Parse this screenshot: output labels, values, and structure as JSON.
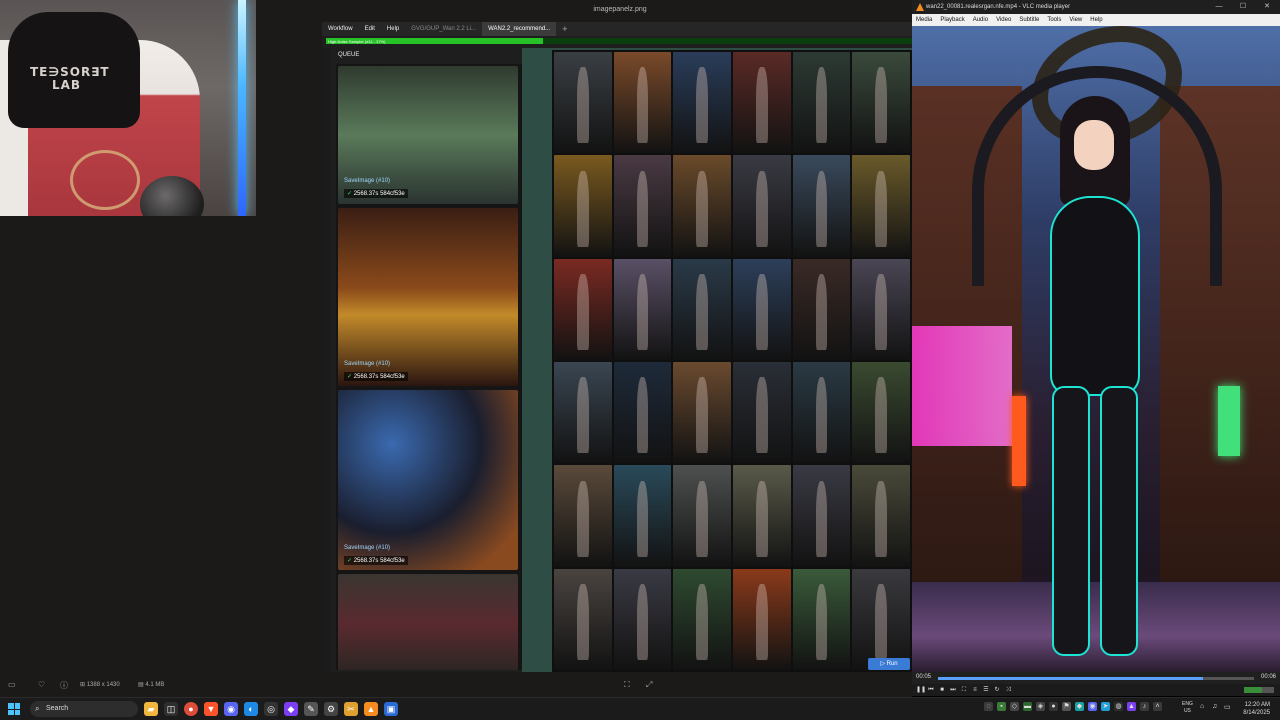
{
  "webcam": {
    "chair_logo_line1": "TE∋SOR∃T",
    "chair_logo_line2": "LAB"
  },
  "image_viewer": {
    "title": "imagepanelz.png",
    "dimensions": "1388 x 1430",
    "file_size": "4.1 MB"
  },
  "comfy": {
    "menu": [
      "Workflow",
      "Edit",
      "Help"
    ],
    "tabs": [
      {
        "label": "GVG/GUP_Wan 2.2 Li...",
        "active": false
      },
      {
        "label": "WAN2.2_recommend...",
        "active": true
      }
    ],
    "add_tab": "+",
    "progress_label": "High-Noise Sampler (#11 - 37%)",
    "progress_fraction": 0.37,
    "queue_title": "QUEUE",
    "queue_items": [
      {
        "node": "SaveImage (#10)",
        "time": "2568.37s",
        "hash": "584cf53e"
      },
      {
        "node": "SaveImage (#10)",
        "time": "2568.37s",
        "hash": "584cf53e"
      },
      {
        "node": "SaveImage (#10)",
        "time": "2568.37s",
        "hash": "584cf53e"
      }
    ],
    "run_button": "Run",
    "grid_colors": [
      "#3a3f44",
      "#7a4a2a",
      "#2a3d5a",
      "#5a2a26",
      "#2d3a34",
      "#3a4a3c",
      "#7a5a1f",
      "#4a3a44",
      "#6a4a2a",
      "#3a3a44",
      "#3a4a5c",
      "#6a5a2a",
      "#7a2a22",
      "#5a5066",
      "#2a3a48",
      "#2d3f5a",
      "#3a2a26",
      "#4a4654",
      "#3a4652",
      "#1e2a3a",
      "#6a4a2f",
      "#2a2e36",
      "#2a3a44",
      "#3a4a30",
      "#5a4a3a",
      "#2a4a5a",
      "#4e5050",
      "#5a5a4a",
      "#3a3a44",
      "#4a4a3a",
      "#4a4440",
      "#3a3a44",
      "#2e4a30",
      "#8a3a1a",
      "#3a5a3a",
      "#3a3a3f"
    ]
  },
  "vlc": {
    "title": "wan22_00081.realesrgan.nfe.mp4 - VLC media player",
    "menu": [
      "Media",
      "Playback",
      "Audio",
      "Video",
      "Subtitle",
      "Tools",
      "View",
      "Help"
    ],
    "time_elapsed": "00:05",
    "time_total": "00:06",
    "progress_fraction": 0.84,
    "volume": "100%",
    "window_controls": [
      "—",
      "☐",
      "✕"
    ]
  },
  "taskbar": {
    "search_placeholder": "Search",
    "language": "ENG",
    "region": "US",
    "time": "12:20 AM",
    "date": "8/14/2025"
  }
}
